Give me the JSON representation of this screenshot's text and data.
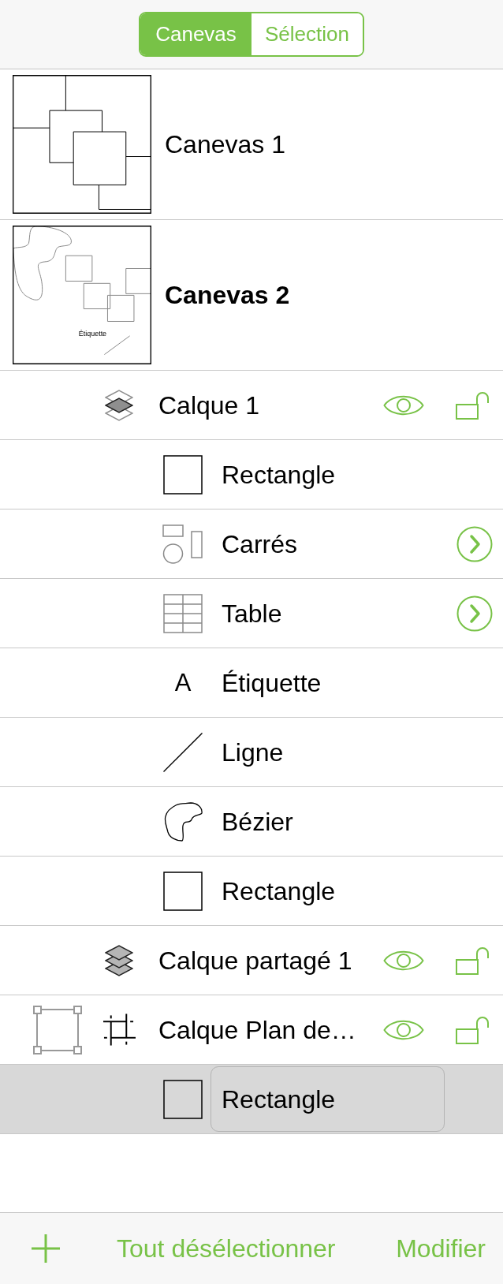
{
  "segmented_control": [
    {
      "label": "Canevas",
      "selected": true
    },
    {
      "label": "Sélection",
      "selected": false
    }
  ],
  "canvases": [
    {
      "name": "Canevas 1",
      "selected": false,
      "kind": "squares"
    },
    {
      "name": "Canevas 2",
      "selected": true,
      "kind": "shapes",
      "thumbnail_text": "Étiquette",
      "children": [
        {
          "name": "Calque 1",
          "kind": "layer",
          "selected": false,
          "visible": true,
          "locked": false,
          "children": [
            {
              "name": "Rectangle",
              "kind": "rectangle",
              "selected": false
            },
            {
              "name": "Carrés",
              "kind": "group",
              "selected": false
            },
            {
              "name": "Table",
              "kind": "table",
              "selected": false
            },
            {
              "name": "Étiquette",
              "kind": "text",
              "icon_text": "A",
              "selected": false
            },
            {
              "name": "Ligne",
              "kind": "line",
              "selected": false
            },
            {
              "name": "Bézier",
              "kind": "bezier",
              "selected": false
            },
            {
              "name": "Rectangle",
              "kind": "rectangle",
              "selected": false
            }
          ]
        },
        {
          "name": "Calque partagé 1",
          "kind": "shared",
          "selected": false,
          "visible": true,
          "locked": false
        },
        {
          "name": "Calque Plan de…",
          "kind": "artboard",
          "selected": false,
          "visible": true,
          "locked": false,
          "children": [
            {
              "name": "Rectangle",
              "kind": "rectangle",
              "selected": true
            }
          ]
        }
      ]
    }
  ],
  "toolbar": [
    {
      "kind": "add"
    },
    {
      "kind": "text",
      "label": "Tout désélectionner"
    },
    {
      "kind": "text",
      "label": "Modifier"
    }
  ]
}
